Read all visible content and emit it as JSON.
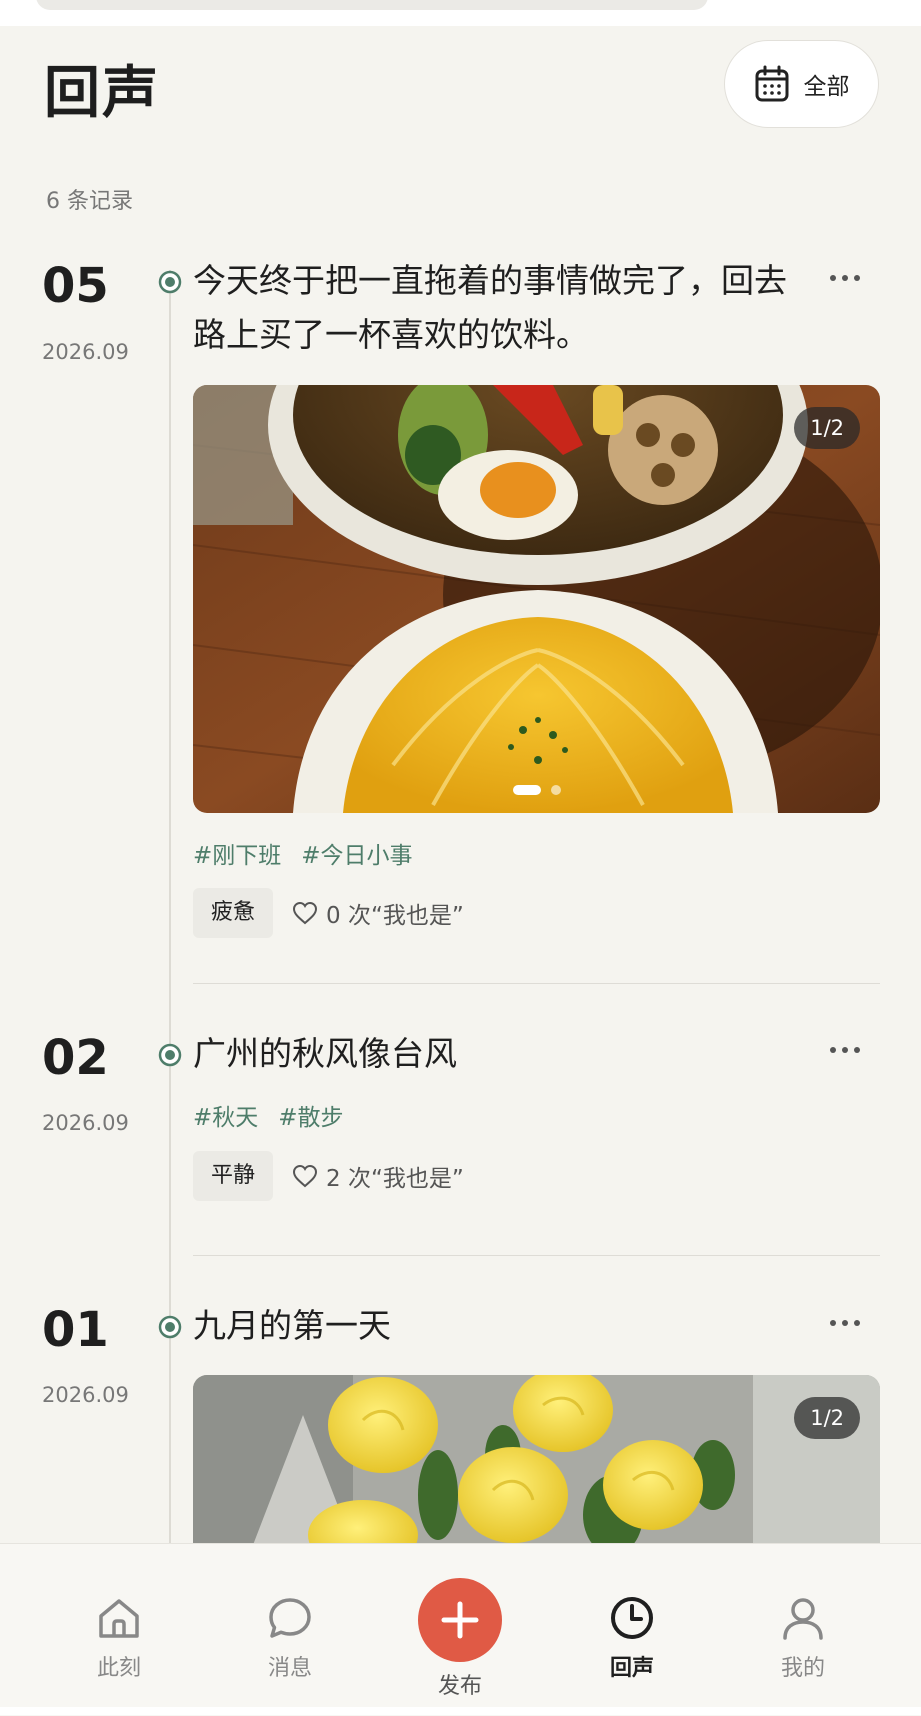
{
  "header": {
    "title": "回声",
    "filter_label": "全部",
    "record_count": "6 条记录"
  },
  "entries": [
    {
      "day": "05",
      "year_month": "2026.09",
      "text_line1": "今天终于把一直拖着的事情做完了，回去",
      "text_line2": "路上买了一杯喜欢的饮料。",
      "photo_counter": "1/2",
      "tags": [
        "#刚下班",
        "#今日小事"
      ],
      "mood": "疲惫",
      "me_too": "0 次“我也是”"
    },
    {
      "day": "02",
      "year_month": "2026.09",
      "text": "广州的秋风像台风",
      "tags": [
        "#秋天",
        "#散步"
      ],
      "mood": "平静",
      "me_too": "2 次“我也是”"
    },
    {
      "day": "01",
      "year_month": "2026.09",
      "text": "九月的第一天",
      "photo_counter": "1/2"
    }
  ],
  "nav": {
    "items": [
      {
        "label": "此刻",
        "icon": "home-icon"
      },
      {
        "label": "消息",
        "icon": "chat-bubble-icon"
      },
      {
        "label": "发布",
        "icon": "plus-icon"
      },
      {
        "label": "回声",
        "icon": "clock-icon"
      },
      {
        "label": "我的",
        "icon": "user-icon"
      }
    ],
    "active": "回声"
  },
  "colors": {
    "background": "#f5f4ef",
    "accent_green": "#4e7d6a",
    "publish_red": "#e05a45"
  }
}
